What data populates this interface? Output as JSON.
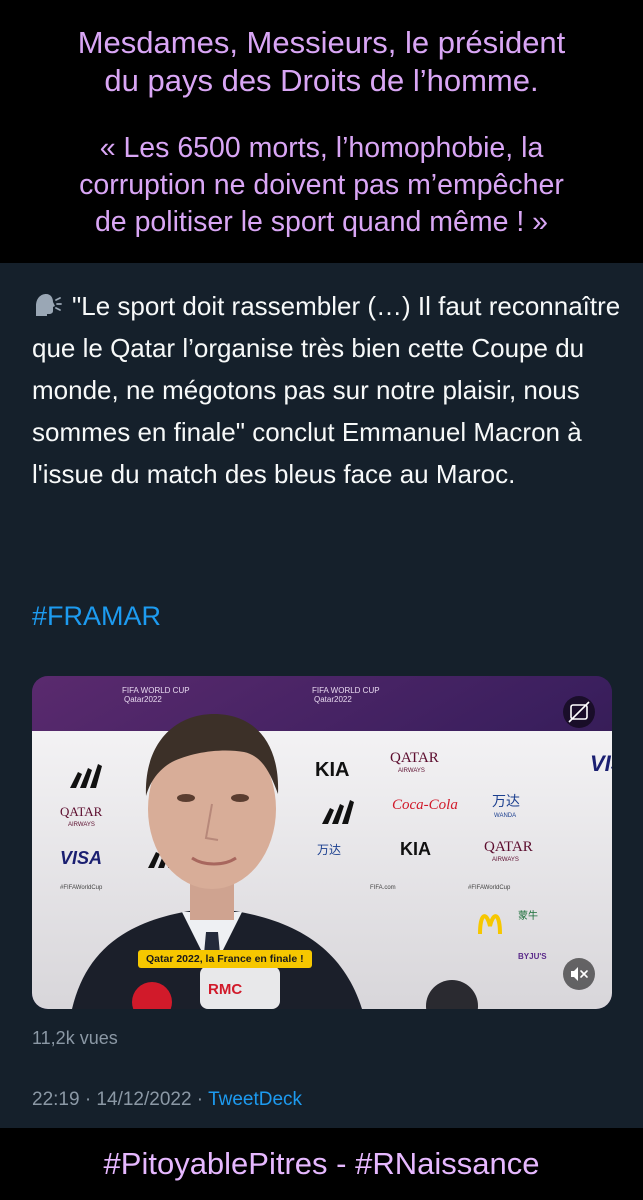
{
  "banner_top": {
    "line1a": "Mesdames, Messieurs, le président",
    "line1b": "du pays des Droits de l’homme.",
    "line2a": "« Les 6500 morts, l’homophobie, la",
    "line2b": "corruption ne doivent pas m’empêcher",
    "line2c": "de politiser le sport quand même ! »"
  },
  "tweet": {
    "lead_icon": "speaking-head-icon",
    "text": "\"Le sport doit rassembler (…) Il faut reconnaître que le Qatar l’organise très bien cette Coupe du monde, ne mégotons pas sur notre plaisir, nous sommes en finale\" conclut Emmanuel Macron à l'issue du match des bleus face au Maroc.",
    "hashtag": "#FRAMAR",
    "video": {
      "caption": "Qatar 2022, la France en finale !",
      "backdrop": {
        "fifa1": "FIFA WORLD CUP",
        "fifa2": "Qatar2022",
        "qatar": "QATAR",
        "airways": "AIRWAYS",
        "kia": "KIA",
        "coca": "Coca-Cola",
        "wanda": "万达",
        "wanda_en": "WANDA",
        "visa": "VISA",
        "tag": "#FIFAWorldCup",
        "fifacom": "FIFA.com",
        "byjus": "BYJU'S",
        "mengniu": "蒙牛",
        "rmc": "RMC"
      }
    },
    "views": "11,2k vues",
    "time": "22:19 · 14/12/2022 · ",
    "source": "TweetDeck"
  },
  "banner_bottom": "#PitoyablePitres - #RNaissance",
  "colors": {
    "banner_text": "#d9a6f5",
    "tweet_bg": "#15202b",
    "link": "#1d9bf0",
    "muted": "#8b98a5",
    "caption_bg": "#f6c700"
  }
}
